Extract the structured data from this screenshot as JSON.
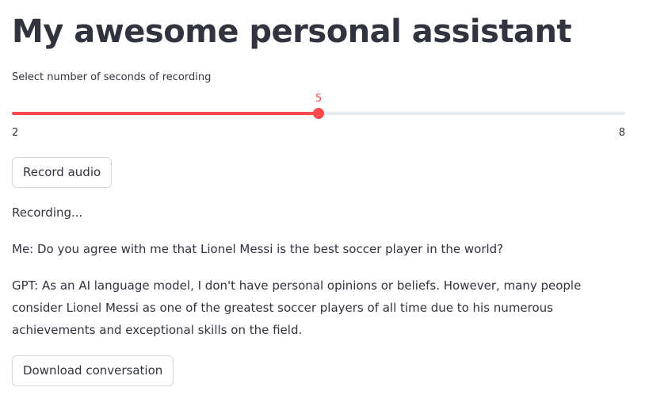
{
  "page": {
    "title": "My awesome personal assistant"
  },
  "slider": {
    "label": "Select number of seconds of recording",
    "min": 2,
    "max": 8,
    "value": 5,
    "min_label": "2",
    "max_label": "8",
    "value_label": "5"
  },
  "buttons": {
    "record_label": "Record audio",
    "download_label": "Download conversation"
  },
  "status": {
    "text": "Recording..."
  },
  "conversation": {
    "me": "Me: Do you agree with me that Lionel Messi is the best soccer player in the world?",
    "gpt": "GPT: As an AI language model, I don't have personal opinions or beliefs. However, many people consider Lionel Messi as one of the greatest soccer players of all time due to his numerous achievements and exceptional skills on the field."
  },
  "colors": {
    "accent": "#ff4b4b",
    "track": "#e6eaf1",
    "text": "#31333f"
  }
}
